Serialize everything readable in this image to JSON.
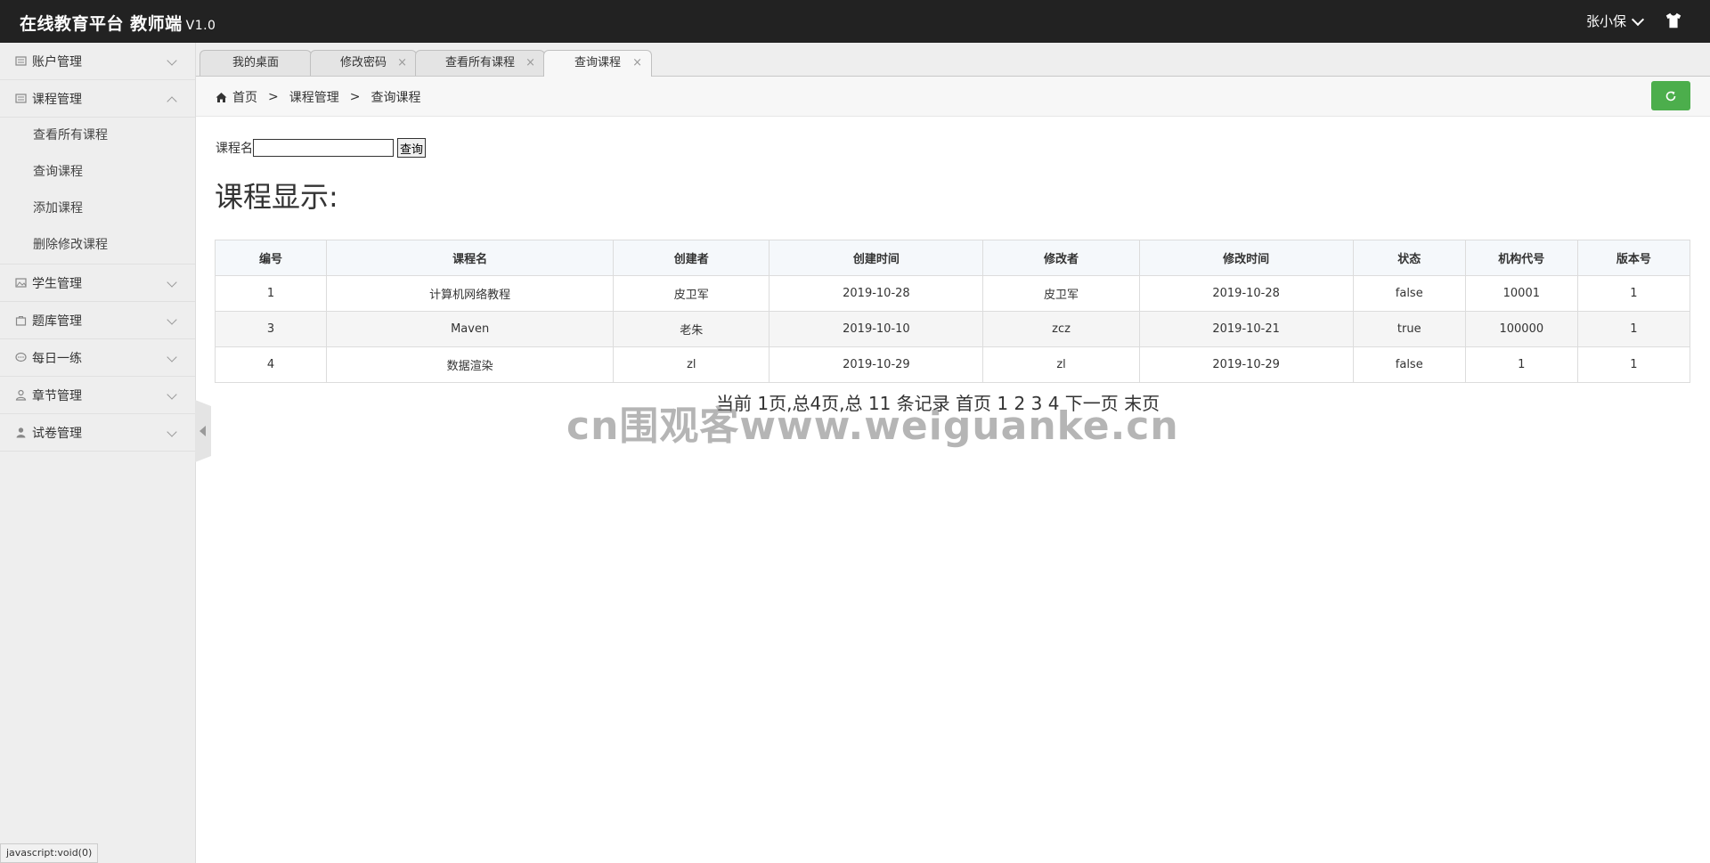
{
  "header": {
    "brand": "在线教育平台 教师端",
    "version": "V1.0",
    "user_name": "张小保",
    "theme_icon": "tshirt-icon"
  },
  "sidebar": {
    "items": [
      {
        "label": "账户管理",
        "icon": "book-icon",
        "expanded": false
      },
      {
        "label": "课程管理",
        "icon": "book-icon",
        "expanded": true,
        "children": [
          "查看所有课程",
          "查询课程",
          "添加课程",
          "删除修改课程"
        ]
      },
      {
        "label": "学生管理",
        "icon": "image-icon",
        "expanded": false
      },
      {
        "label": "题库管理",
        "icon": "bag-icon",
        "expanded": false
      },
      {
        "label": "每日一练",
        "icon": "chat-icon",
        "expanded": false
      },
      {
        "label": "章节管理",
        "icon": "user-outline-icon",
        "expanded": false
      },
      {
        "label": "试卷管理",
        "icon": "user-icon",
        "expanded": false
      }
    ]
  },
  "tabs": [
    {
      "label": "我的桌面",
      "closable": false,
      "active": false
    },
    {
      "label": "修改密码",
      "closable": true,
      "active": false
    },
    {
      "label": "查看所有课程",
      "closable": true,
      "active": false
    },
    {
      "label": "查询课程",
      "closable": true,
      "active": true
    }
  ],
  "tab_close_glyph": "×",
  "breadcrumb": {
    "home": "首页",
    "sep": ">",
    "level1": "课程管理",
    "level2": "查询课程"
  },
  "search": {
    "label": "课程名",
    "value": "",
    "button": "查询"
  },
  "section_title": "课程显示:",
  "table": {
    "headers": [
      "编号",
      "课程名",
      "创建者",
      "创建时间",
      "修改者",
      "修改时间",
      "状态",
      "机构代号",
      "版本号"
    ],
    "rows": [
      [
        "1",
        "计算机网络教程",
        "皮卫军",
        "2019-10-28",
        "皮卫军",
        "2019-10-28",
        "false",
        "10001",
        "1"
      ],
      [
        "3",
        "Maven",
        "老朱",
        "2019-10-10",
        "zcz",
        "2019-10-21",
        "true",
        "100000",
        "1"
      ],
      [
        "4",
        "数据渲染",
        "zl",
        "2019-10-29",
        "zl",
        "2019-10-29",
        "false",
        "1",
        "1"
      ]
    ]
  },
  "pager": {
    "summary": "当前 1页,总4页,总 11 条记录",
    "first": "首页",
    "pages": [
      "1",
      "2",
      "3",
      "4"
    ],
    "next": "下一页",
    "last": "末页"
  },
  "watermark": "cn围观客www.weiguanke.cn",
  "status_bar": "javascript:void(0)",
  "colors": {
    "header_bg": "#222222",
    "sidebar_bg": "#eeeeee",
    "refresh_button": "#4cae4c"
  }
}
